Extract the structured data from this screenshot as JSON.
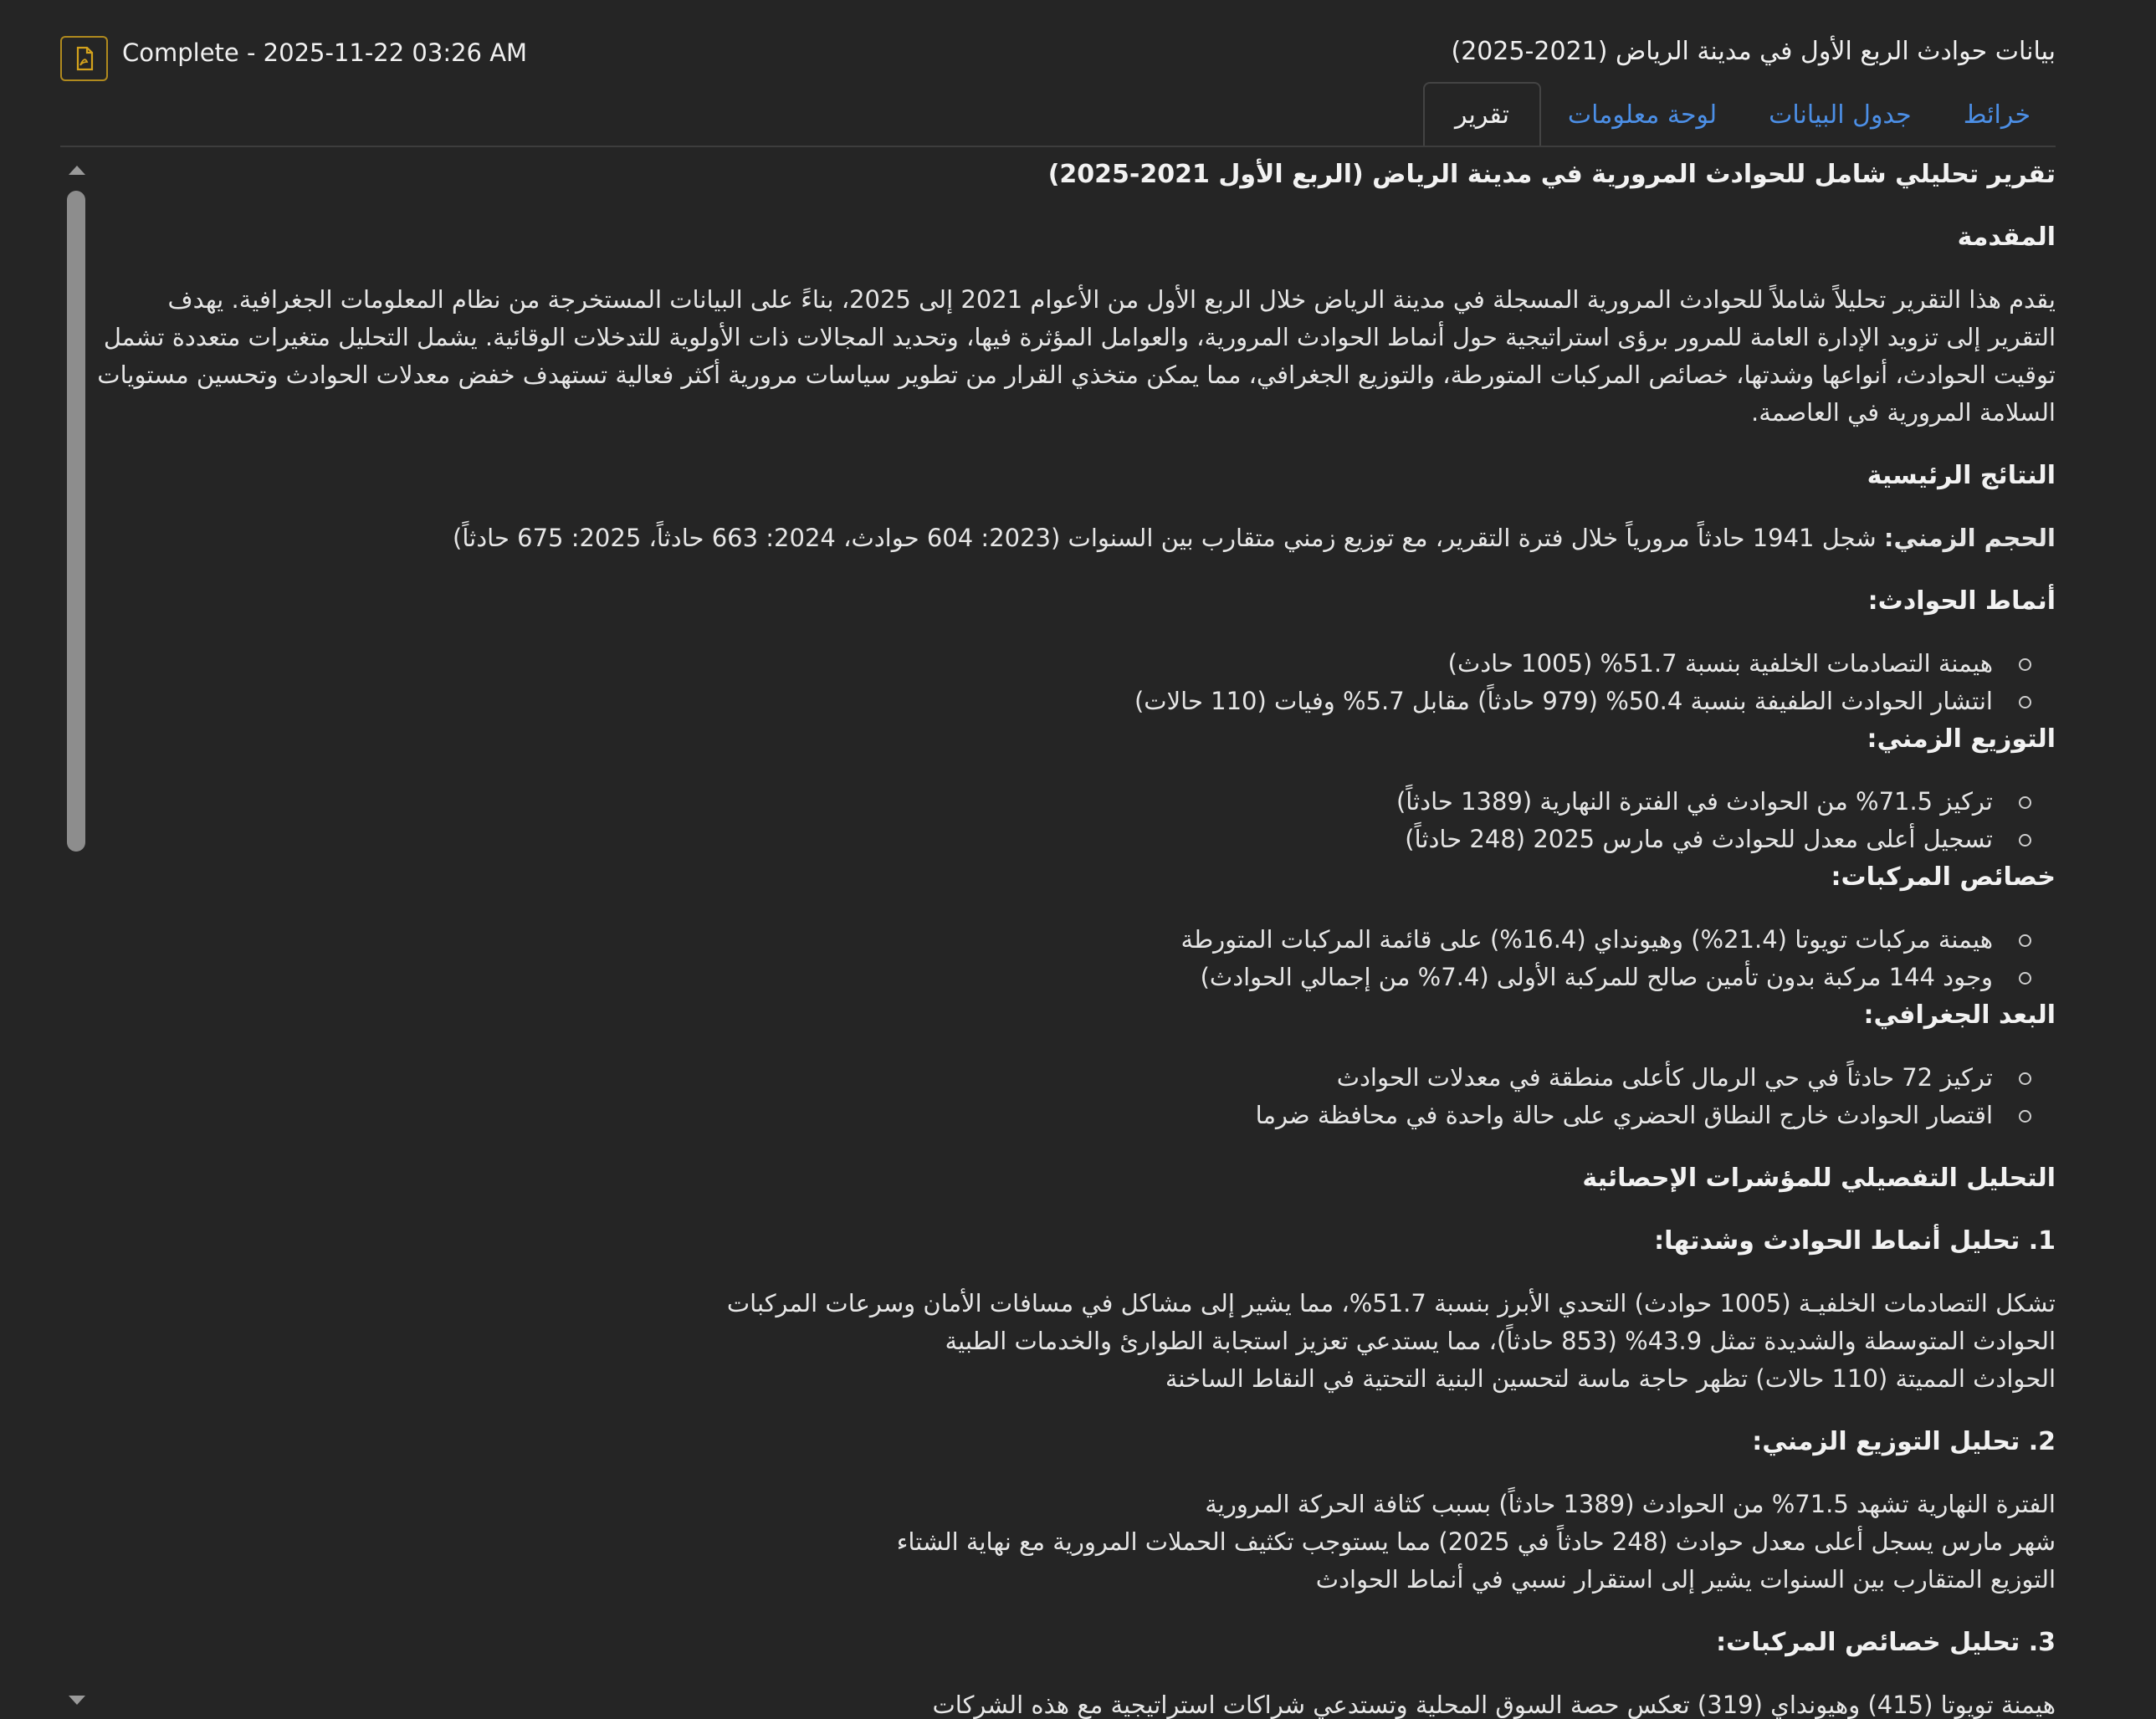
{
  "header": {
    "title": "بيانات حوادث الربع الأول في مدينة الرياض (2021-2025)",
    "status": "Complete - 2025-11-22 03:26 AM",
    "export_icon": "pdf-file-icon"
  },
  "tabs": [
    {
      "label": "تقرير",
      "active": true
    },
    {
      "label": "لوحة معلومات",
      "active": false
    },
    {
      "label": "جدول البيانات",
      "active": false
    },
    {
      "label": "خرائط",
      "active": false
    }
  ],
  "report": {
    "title": "تقرير تحليلي شامل للحوادث المرورية في مدينة الرياض (الربع الأول 2021-2025)",
    "intro_heading": "المقدمة",
    "intro_text": "يقدم هذا التقرير تحليلاً شاملاً للحوادث المرورية المسجلة في مدينة الرياض خلال الربع الأول من الأعوام 2021 إلى 2025، بناءً على البيانات المستخرجة من نظام المعلومات الجغرافية. يهدف التقرير إلى تزويد الإدارة العامة للمرور برؤى استراتيجية حول أنماط الحوادث المرورية، والعوامل المؤثرة فيها، وتحديد المجالات ذات الأولوية للتدخلات الوقائية. يشمل التحليل متغيرات متعددة تشمل توقيت الحوادث، أنواعها وشدتها، خصائص المركبات المتورطة، والتوزيع الجغرافي، مما يمكن متخذي القرار من تطوير سياسات مرورية أكثر فعالية تستهدف خفض معدلات الحوادث وتحسين مستويات السلامة المرورية في العاصمة.",
    "findings_heading": "النتائج الرئيسية",
    "volume_label": "الحجم الزمني:",
    "volume_text": " شجل 1941 حادثاً مرورياً خلال فترة التقرير، مع توزيع زمني متقارب بين السنوات (2023: 604 حوادث، 2024: 663 حادثاً، 2025: 675 حادثاً)",
    "patterns_heading": "أنماط الحوادث:",
    "patterns": [
      "هيمنة التصادمات الخلفية بنسبة 51.7% (1005 حادث)",
      "انتشار الحوادث الطفيفة بنسبة 50.4% (979 حادثاً) مقابل 5.7% وفيات (110 حالات)"
    ],
    "temporal_heading": "التوزيع الزمني:",
    "temporal": [
      "تركيز 71.5% من الحوادث في الفترة النهارية (1389 حادثاً)",
      "تسجيل أعلى معدل للحوادث في مارس 2025 (248 حادثاً)"
    ],
    "vehicles_heading": "خصائص المركبات:",
    "vehicles": [
      "هيمنة مركبات تويوتا (21.4%) وهيونداي (16.4%) على قائمة المركبات المتورطة",
      "وجود 144 مركبة بدون تأمين صالح للمركبة الأولى (7.4% من إجمالي الحوادث)"
    ],
    "geo_heading": "البعد الجغرافي:",
    "geo": [
      "تركيز 72 حادثاً في حي الرمال كأعلى منطقة في معدلات الحوادث",
      "اقتصار الحوادث خارج النطاق الحضري على حالة واحدة في محافظة ضرما"
    ],
    "detail_heading": "التحليل التفصيلي للمؤشرات الإحصائية",
    "section1_heading": "1. تحليل أنماط الحوادث وشدتها:",
    "section1_lines": [
      "تشكل التصادمات الخلفيـة (1005 حوادث) التحدي الأبرز بنسبة 51.7%، مما يشير إلى مشاكل في مسافات الأمان وسرعات المركبات",
      "الحوادث المتوسطة والشديدة تمثل 43.9% (853 حادثاً)، مما يستدعي تعزيز استجابة الطوارئ والخدمات الطبية",
      "الحوادث المميتة (110 حالات) تظهر حاجة ماسة لتحسين البنية التحتية في النقاط الساخنة"
    ],
    "section2_heading": "2. تحليل التوزيع الزمني:",
    "section2_lines": [
      "الفترة النهارية تشهد 71.5% من الحوادث (1389 حادثاً) بسبب كثافة الحركة المرورية",
      "شهر مارس يسجل أعلى معدل حوادث (248 حادثاً في 2025) مما يستوجب تكثيف الحملات المرورية مع نهاية الشتاء",
      "التوزيع المتقارب بين السنوات يشير إلى استقرار نسبي في أنماط الحوادث"
    ],
    "section3_heading": "3. تحليل خصائص المركبات:",
    "section3_lines": [
      "هيمنة تويوتا (415) وهيونداي (319) تعكس حصة السوق المحلية وتستدعي شراكات استراتيجية مع هذه الشركات"
    ]
  }
}
